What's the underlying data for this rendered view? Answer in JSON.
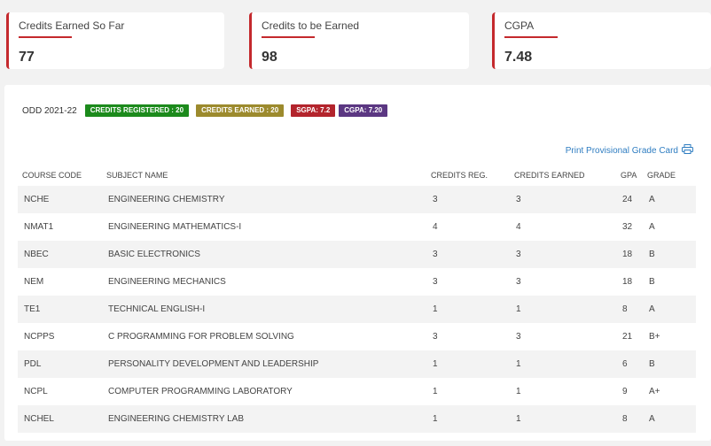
{
  "cards": [
    {
      "label": "Credits Earned So Far",
      "value": "77"
    },
    {
      "label": "Credits to be Earned",
      "value": "98"
    },
    {
      "label": "CGPA",
      "value": "7.48"
    }
  ],
  "semester": {
    "label": "ODD 2021-22",
    "credits_registered": "CREDITS REGISTERED : 20",
    "credits_earned": "CREDITS EARNED : 20",
    "sgpa": "SGPA: 7.2",
    "cgpa": "CGPA: 7.20"
  },
  "print_link": "Print Provisional Grade Card",
  "table": {
    "headers": [
      "COURSE CODE",
      "SUBJECT NAME",
      "CREDITS REG.",
      "CREDITS EARNED",
      "GPA",
      "GRADE"
    ],
    "rows": [
      [
        "NCHE",
        "ENGINEERING CHEMISTRY",
        "3",
        "3",
        "24",
        "A"
      ],
      [
        "NMAT1",
        "ENGINEERING MATHEMATICS-I",
        "4",
        "4",
        "32",
        "A"
      ],
      [
        "NBEC",
        "BASIC ELECTRONICS",
        "3",
        "3",
        "18",
        "B"
      ],
      [
        "NEM",
        "ENGINEERING MECHANICS",
        "3",
        "3",
        "18",
        "B"
      ],
      [
        "TE1",
        "TECHNICAL ENGLISH-I",
        "1",
        "1",
        "8",
        "A"
      ],
      [
        "NCPPS",
        "C PROGRAMMING FOR PROBLEM SOLVING",
        "3",
        "3",
        "21",
        "B+"
      ],
      [
        "PDL",
        "PERSONALITY DEVELOPMENT AND LEADERSHIP",
        "1",
        "1",
        "6",
        "B"
      ],
      [
        "NCPL",
        "COMPUTER PROGRAMMING LABORATORY",
        "1",
        "1",
        "9",
        "A+"
      ],
      [
        "NCHEL",
        "ENGINEERING CHEMISTRY LAB",
        "1",
        "1",
        "8",
        "A"
      ]
    ]
  },
  "colors": {
    "accent": "#c4292d",
    "registered": "#1c8a1c",
    "earned": "#9c8a2d",
    "sgpa": "#b3242c",
    "cgpa": "#5b3782",
    "link": "#2f7dc1"
  },
  "icons": {
    "print": "printer-icon"
  }
}
